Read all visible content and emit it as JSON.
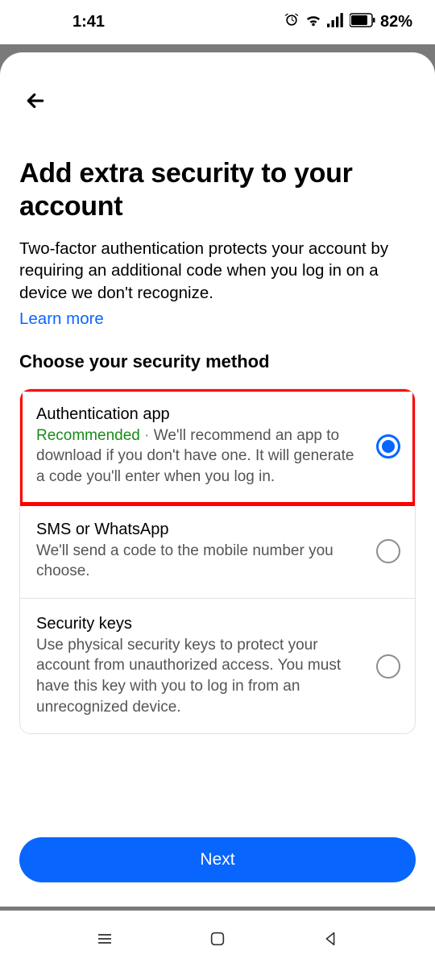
{
  "status": {
    "time": "1:41",
    "battery": "82%"
  },
  "header": {
    "title": "Add extra security to your account"
  },
  "description": "Two-factor authentication protects your account by requiring an additional code when you log in on a device we don't recognize.",
  "learn_more": "Learn more",
  "subheading": "Choose your security method",
  "options": [
    {
      "title": "Authentication app",
      "recommended_label": "Recommended",
      "separator": " · ",
      "desc": "We'll recommend an app to download if you don't have one. It will generate a code you'll enter when you log in.",
      "selected": true,
      "highlighted": true
    },
    {
      "title": "SMS or WhatsApp",
      "desc": "We'll send a code to the mobile number you choose.",
      "selected": false
    },
    {
      "title": "Security keys",
      "desc": "Use physical security keys to protect your account from unauthorized access. You must have this key with you to log in from an unrecognized device.",
      "selected": false
    }
  ],
  "next_label": "Next"
}
